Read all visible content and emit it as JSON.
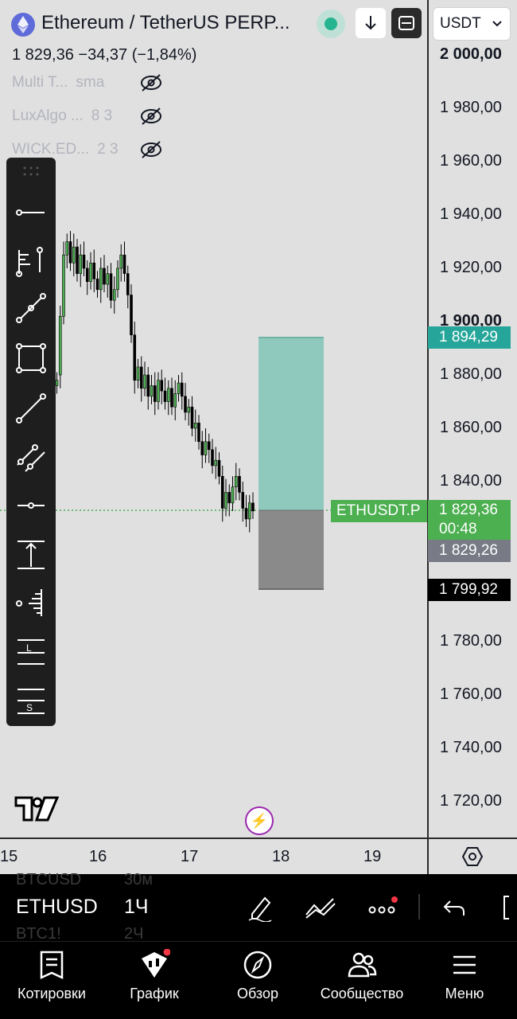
{
  "header": {
    "symbol_title": "Ethereum / TetherUS PERP...",
    "price_line": "1 829,36  −34,37 (−1,84%)",
    "currency": "USDT"
  },
  "indicators": [
    {
      "name": "Multi T...",
      "params": "sma"
    },
    {
      "name": "LuxAlgo ...",
      "params": "8 3"
    },
    {
      "name": "WICK.ED...",
      "params": "2 3"
    }
  ],
  "price_scale": {
    "ticks": [
      "2 000,00",
      "1 980,00",
      "1 960,00",
      "1 940,00",
      "1 920,00",
      "1 900,00",
      "1 880,00",
      "1 860,00",
      "1 840,00",
      "1 780,00",
      "1 760,00",
      "1 740,00",
      "1 720,00"
    ],
    "labels": {
      "target": "1 894,29",
      "current": "1 829,36",
      "countdown": "00:48",
      "entry": "1 829,26",
      "stop": "1 799,92"
    },
    "symbol_label": "ETHUSDT.P",
    "colors": {
      "up": "#4caf50",
      "target": "#26a69a",
      "entry": "#787b86",
      "stop": "#000000"
    }
  },
  "time_axis": {
    "ticks": [
      "15",
      "16",
      "17",
      "18",
      "19"
    ]
  },
  "position": {
    "type": "long",
    "entry": 1829.26,
    "target": 1894.29,
    "stop": 1799.92,
    "profit_color": "#8fc9bd",
    "loss_color": "#8a8a8a"
  },
  "bottom_bar": {
    "symbol": "ETHUSD",
    "interval": "1Ч",
    "ghost_above": [
      "BTCUSD",
      "30м"
    ],
    "ghost_below": [
      "BTC1!",
      "2Ч"
    ]
  },
  "nav": {
    "items": [
      {
        "label": "Котировки",
        "icon": "quotes-icon"
      },
      {
        "label": "График",
        "icon": "chart-icon"
      },
      {
        "label": "Обзор",
        "icon": "compass-icon"
      },
      {
        "label": "Сообщество",
        "icon": "community-icon"
      },
      {
        "label": "Меню",
        "icon": "menu-icon"
      }
    ]
  }
}
